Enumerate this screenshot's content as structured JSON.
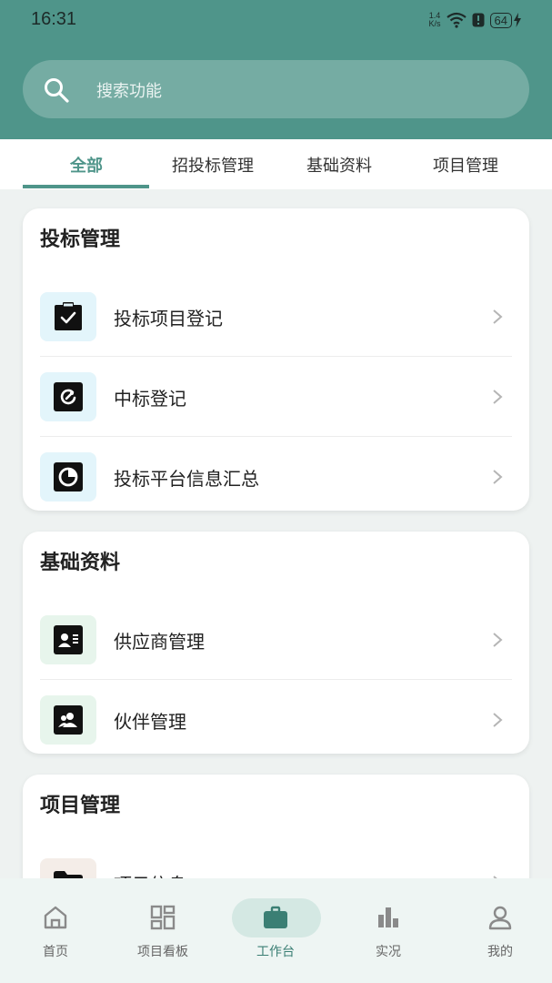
{
  "status_bar": {
    "time": "16:31",
    "net_speed_value": "1.4",
    "net_speed_unit": "K/s",
    "battery": "64"
  },
  "search": {
    "placeholder": "搜索功能"
  },
  "tabs": [
    {
      "label": "全部",
      "active": true
    },
    {
      "label": "招投标管理",
      "active": false
    },
    {
      "label": "基础资料",
      "active": false
    },
    {
      "label": "项目管理",
      "active": false
    }
  ],
  "sections": [
    {
      "title": "投标管理",
      "items": [
        {
          "label": "投标项目登记",
          "icon": "clipboard-check-icon"
        },
        {
          "label": "中标登记",
          "icon": "refresh-badge-icon"
        },
        {
          "label": "投标平台信息汇总",
          "icon": "pie-chart-icon"
        }
      ]
    },
    {
      "title": "基础资料",
      "items": [
        {
          "label": "供应商管理",
          "icon": "contact-card-icon"
        },
        {
          "label": "伙伴管理",
          "icon": "partner-icon"
        }
      ]
    },
    {
      "title": "项目管理",
      "items": [
        {
          "label": "项目信息",
          "icon": "folder-list-icon"
        }
      ]
    }
  ],
  "bottom_nav": [
    {
      "label": "首页",
      "icon": "home-icon",
      "active": false
    },
    {
      "label": "项目看板",
      "icon": "dashboard-icon",
      "active": false
    },
    {
      "label": "工作台",
      "icon": "briefcase-icon",
      "active": true
    },
    {
      "label": "实况",
      "icon": "bar-chart-icon",
      "active": false
    },
    {
      "label": "我的",
      "icon": "user-icon",
      "active": false
    }
  ],
  "colors": {
    "primary": "#4f958a",
    "active_pill": "#d4e8e3"
  }
}
